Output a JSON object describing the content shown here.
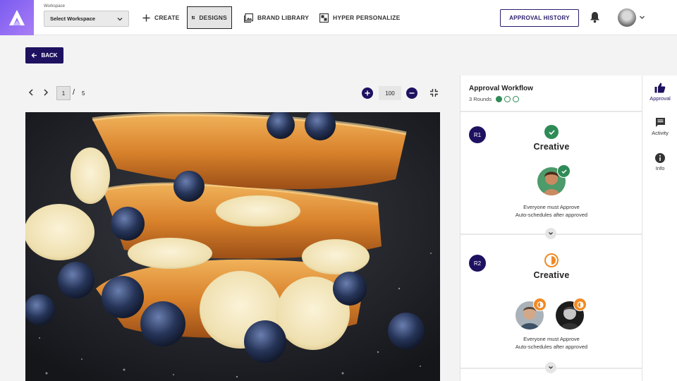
{
  "header": {
    "workspace_label": "Workspace",
    "workspace_value": "Select Workspace",
    "nav": {
      "create": "CREATE",
      "designs": "DESIGNS",
      "brand_library": "BRAND LIBRARY",
      "hyper_personalize": "HYPER PERSONALIZE"
    },
    "approval_history": "APPROVAL HISTORY"
  },
  "back_label": "BACK",
  "pager": {
    "current": "1",
    "separator": "/",
    "total": "5"
  },
  "zoom": {
    "value": "100"
  },
  "workflow": {
    "title": "Approval Workflow",
    "rounds_label": "3 Rounds",
    "rounds_status": [
      "complete",
      "pending",
      "pending"
    ],
    "status_colors": {
      "complete": "#2e8b57",
      "in_progress": "#f08a24"
    },
    "rounds": [
      {
        "badge": "R1",
        "name": "Creative",
        "status": "approved",
        "rule": "Everyone must Approve",
        "schedule": "Auto-schedules after approved"
      },
      {
        "badge": "R2",
        "name": "Creative",
        "status": "in-progress",
        "rule": "Everyone must Approve",
        "schedule": "Auto-schedules after approved"
      }
    ]
  },
  "side_tabs": {
    "approval": "Approval",
    "activity": "Activity",
    "info": "Info"
  },
  "accent_color": "#1e1160"
}
